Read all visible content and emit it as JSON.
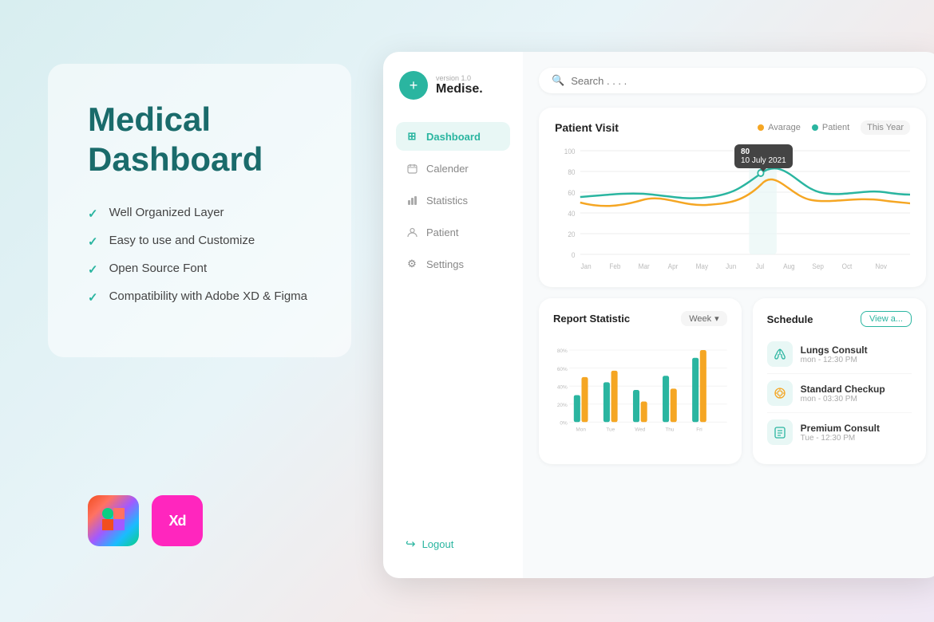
{
  "page": {
    "bg_gradient": "linear-gradient(135deg, #d8eef0 0%, #e8f4f8 40%, #f5e8e8 70%, #f0e8f5 100%)"
  },
  "left_panel": {
    "title_line1": "Medical",
    "title_line2": "Dashboard",
    "features": [
      "Well Organized Layer",
      "Easy to use and Customize",
      "Open Source Font",
      "Compatibility with Adobe XD & Figma"
    ],
    "logos": [
      {
        "name": "Figma",
        "type": "figma"
      },
      {
        "name": "Adobe XD",
        "type": "xd"
      }
    ]
  },
  "sidebar": {
    "brand": {
      "version": "version 1.0",
      "name": "Medise."
    },
    "nav_items": [
      {
        "label": "Dashboard",
        "icon": "⊞",
        "active": true
      },
      {
        "label": "Calender",
        "icon": "📅",
        "active": false
      },
      {
        "label": "Statistics",
        "icon": "📊",
        "active": false
      },
      {
        "label": "Patient",
        "icon": "⚕",
        "active": false
      },
      {
        "label": "Settings",
        "icon": "⚙",
        "active": false
      }
    ],
    "logout_label": "Logout"
  },
  "search": {
    "placeholder": "Search . . . ."
  },
  "patient_visit_chart": {
    "title": "Patient Visit",
    "legend": {
      "average": "Avarage",
      "patient": "Patient",
      "period": "This Year"
    },
    "tooltip": {
      "value": "80",
      "date": "10 July 2021"
    },
    "y_labels": [
      "100",
      "80",
      "60",
      "40",
      "20",
      "0"
    ],
    "x_labels": [
      "Jan",
      "Feb",
      "Mar",
      "Apr",
      "May",
      "Jun",
      "Jul",
      "Aug",
      "Sep",
      "Oct",
      "Nov"
    ]
  },
  "report_statistic": {
    "title": "Report Statistic",
    "period": "Week",
    "y_labels": [
      "80%",
      "60%",
      "40%",
      "20%",
      "0%"
    ],
    "x_labels": [
      "Mon",
      "Tue",
      "Wed",
      "Thu",
      "Fri"
    ]
  },
  "schedule": {
    "title": "Schedule",
    "view_all": "View a...",
    "items": [
      {
        "name": "Lungs Consult",
        "time": "mon - 12:30 PM",
        "icon": "🫁"
      },
      {
        "name": "Standard Checkup",
        "time": "mon - 03:30 PM",
        "icon": "🔬"
      },
      {
        "name": "Premium Consult",
        "time": "Tue - 12:30 PM",
        "icon": "📋"
      }
    ]
  }
}
